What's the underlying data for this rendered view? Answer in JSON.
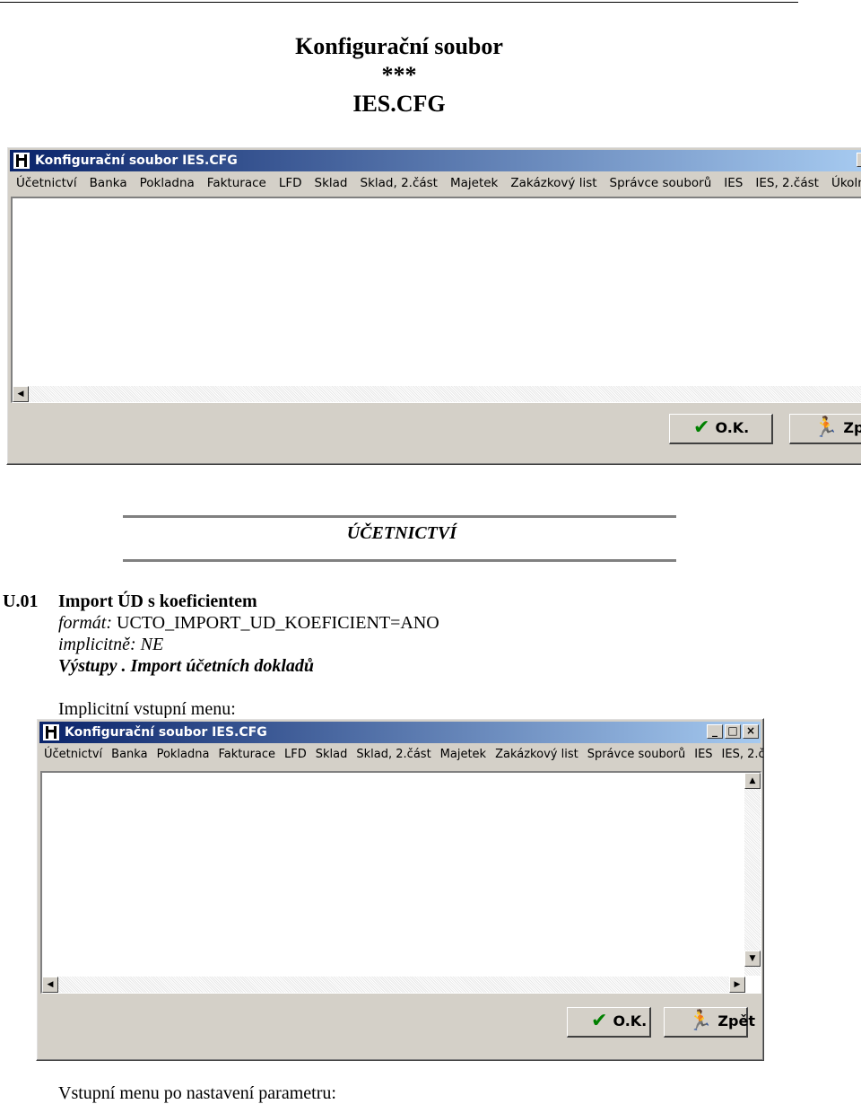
{
  "document": {
    "title_line1": "Konfigurační soubor",
    "title_line2": "***",
    "title_line3": "IES.CFG",
    "section": "ÚČETNICTVÍ",
    "item_code": "U.01",
    "item_title": "Import ÚD s koeficientem",
    "format_label": "formát:",
    "format_value": "UCTO_IMPORT_UD_KOEFICIENT=ANO",
    "default_line": "implicitně: NE",
    "outputs_line": "Výstupy . Import účetních dokladů",
    "implicit_menu_label": "Implicitní vstupní menu:",
    "input_menu_after_label": "Vstupní menu po nastavení parametru:"
  },
  "window": {
    "title": "Konfigurační soubor IES.CFG",
    "menu": [
      "Účetnictví",
      "Banka",
      "Pokladna",
      "Fakturace",
      "LFD",
      "Sklad",
      "Sklad, 2.část",
      "Majetek",
      "Zakázkový list",
      "Správce souborů",
      "IES",
      "IES, 2.část",
      "Úkolníček"
    ],
    "ok_label": "O.K.",
    "back_label": "Zpět",
    "minimize": "_",
    "maximize": "□",
    "close": "×"
  },
  "icons": {
    "ok": "check-icon",
    "back": "running-man-icon",
    "app": "app-icon"
  }
}
